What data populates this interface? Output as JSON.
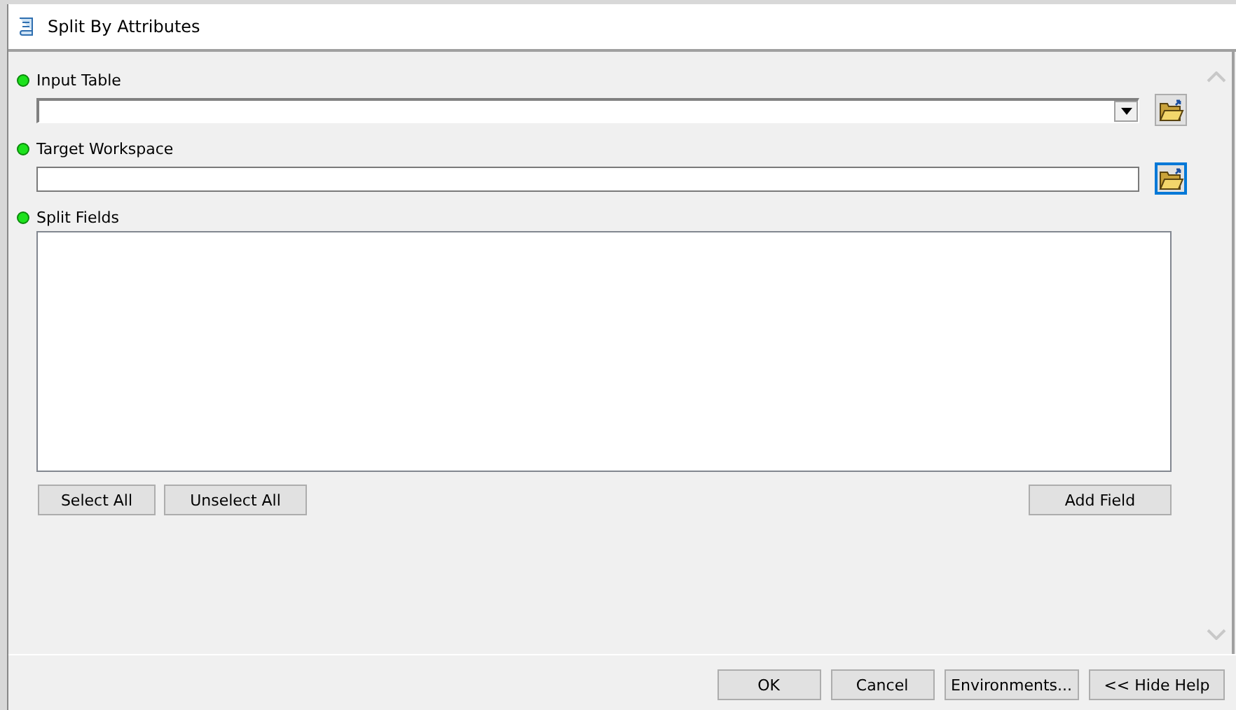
{
  "window": {
    "title": "Split By Attributes"
  },
  "parameters": [
    {
      "label": "Input Table",
      "kind": "combobox",
      "browse": {
        "focused": false
      }
    },
    {
      "label": "Target Workspace",
      "kind": "text",
      "browse": {
        "focused": true
      }
    },
    {
      "label": "Split Fields",
      "kind": "list"
    }
  ],
  "list_buttons": [
    "Select All",
    "Unselect All"
  ],
  "add_field_button": "Add Field",
  "footer_buttons": [
    "OK",
    "Cancel",
    "Environments...",
    "<< Hide Help"
  ]
}
